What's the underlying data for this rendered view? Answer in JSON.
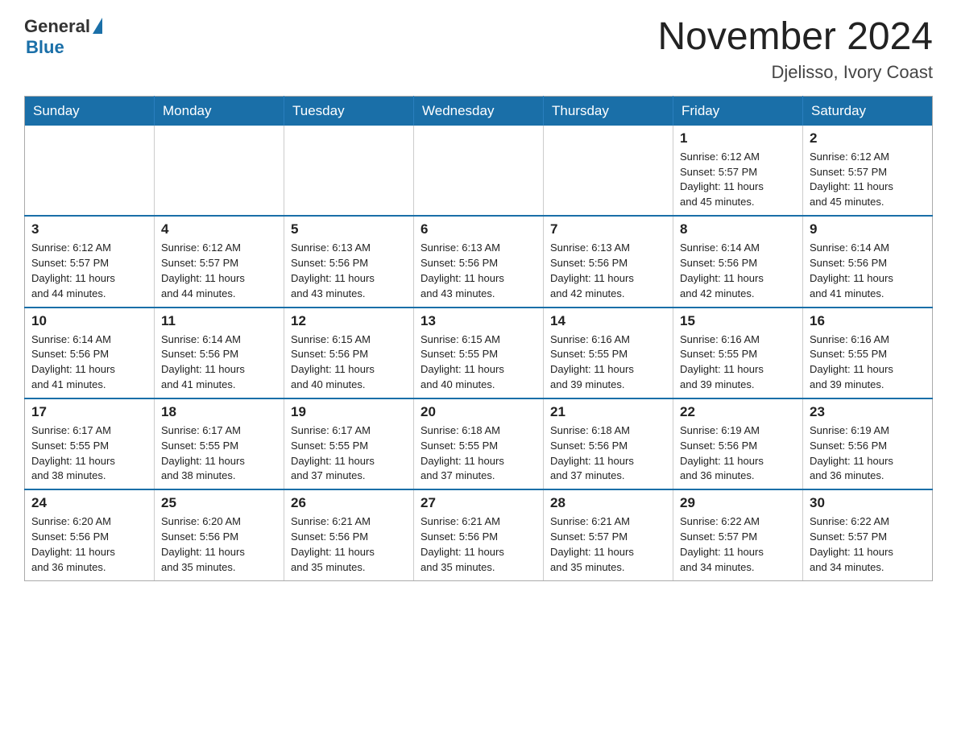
{
  "header": {
    "logo_general": "General",
    "logo_blue": "Blue",
    "month_title": "November 2024",
    "location": "Djelisso, Ivory Coast"
  },
  "days_of_week": [
    "Sunday",
    "Monday",
    "Tuesday",
    "Wednesday",
    "Thursday",
    "Friday",
    "Saturday"
  ],
  "weeks": [
    [
      {
        "day": "",
        "info": "",
        "empty": true
      },
      {
        "day": "",
        "info": "",
        "empty": true
      },
      {
        "day": "",
        "info": "",
        "empty": true
      },
      {
        "day": "",
        "info": "",
        "empty": true
      },
      {
        "day": "",
        "info": "",
        "empty": true
      },
      {
        "day": "1",
        "info": "Sunrise: 6:12 AM\nSunset: 5:57 PM\nDaylight: 11 hours\nand 45 minutes."
      },
      {
        "day": "2",
        "info": "Sunrise: 6:12 AM\nSunset: 5:57 PM\nDaylight: 11 hours\nand 45 minutes."
      }
    ],
    [
      {
        "day": "3",
        "info": "Sunrise: 6:12 AM\nSunset: 5:57 PM\nDaylight: 11 hours\nand 44 minutes."
      },
      {
        "day": "4",
        "info": "Sunrise: 6:12 AM\nSunset: 5:57 PM\nDaylight: 11 hours\nand 44 minutes."
      },
      {
        "day": "5",
        "info": "Sunrise: 6:13 AM\nSunset: 5:56 PM\nDaylight: 11 hours\nand 43 minutes."
      },
      {
        "day": "6",
        "info": "Sunrise: 6:13 AM\nSunset: 5:56 PM\nDaylight: 11 hours\nand 43 minutes."
      },
      {
        "day": "7",
        "info": "Sunrise: 6:13 AM\nSunset: 5:56 PM\nDaylight: 11 hours\nand 42 minutes."
      },
      {
        "day": "8",
        "info": "Sunrise: 6:14 AM\nSunset: 5:56 PM\nDaylight: 11 hours\nand 42 minutes."
      },
      {
        "day": "9",
        "info": "Sunrise: 6:14 AM\nSunset: 5:56 PM\nDaylight: 11 hours\nand 41 minutes."
      }
    ],
    [
      {
        "day": "10",
        "info": "Sunrise: 6:14 AM\nSunset: 5:56 PM\nDaylight: 11 hours\nand 41 minutes."
      },
      {
        "day": "11",
        "info": "Sunrise: 6:14 AM\nSunset: 5:56 PM\nDaylight: 11 hours\nand 41 minutes."
      },
      {
        "day": "12",
        "info": "Sunrise: 6:15 AM\nSunset: 5:56 PM\nDaylight: 11 hours\nand 40 minutes."
      },
      {
        "day": "13",
        "info": "Sunrise: 6:15 AM\nSunset: 5:55 PM\nDaylight: 11 hours\nand 40 minutes."
      },
      {
        "day": "14",
        "info": "Sunrise: 6:16 AM\nSunset: 5:55 PM\nDaylight: 11 hours\nand 39 minutes."
      },
      {
        "day": "15",
        "info": "Sunrise: 6:16 AM\nSunset: 5:55 PM\nDaylight: 11 hours\nand 39 minutes."
      },
      {
        "day": "16",
        "info": "Sunrise: 6:16 AM\nSunset: 5:55 PM\nDaylight: 11 hours\nand 39 minutes."
      }
    ],
    [
      {
        "day": "17",
        "info": "Sunrise: 6:17 AM\nSunset: 5:55 PM\nDaylight: 11 hours\nand 38 minutes."
      },
      {
        "day": "18",
        "info": "Sunrise: 6:17 AM\nSunset: 5:55 PM\nDaylight: 11 hours\nand 38 minutes."
      },
      {
        "day": "19",
        "info": "Sunrise: 6:17 AM\nSunset: 5:55 PM\nDaylight: 11 hours\nand 37 minutes."
      },
      {
        "day": "20",
        "info": "Sunrise: 6:18 AM\nSunset: 5:55 PM\nDaylight: 11 hours\nand 37 minutes."
      },
      {
        "day": "21",
        "info": "Sunrise: 6:18 AM\nSunset: 5:56 PM\nDaylight: 11 hours\nand 37 minutes."
      },
      {
        "day": "22",
        "info": "Sunrise: 6:19 AM\nSunset: 5:56 PM\nDaylight: 11 hours\nand 36 minutes."
      },
      {
        "day": "23",
        "info": "Sunrise: 6:19 AM\nSunset: 5:56 PM\nDaylight: 11 hours\nand 36 minutes."
      }
    ],
    [
      {
        "day": "24",
        "info": "Sunrise: 6:20 AM\nSunset: 5:56 PM\nDaylight: 11 hours\nand 36 minutes."
      },
      {
        "day": "25",
        "info": "Sunrise: 6:20 AM\nSunset: 5:56 PM\nDaylight: 11 hours\nand 35 minutes."
      },
      {
        "day": "26",
        "info": "Sunrise: 6:21 AM\nSunset: 5:56 PM\nDaylight: 11 hours\nand 35 minutes."
      },
      {
        "day": "27",
        "info": "Sunrise: 6:21 AM\nSunset: 5:56 PM\nDaylight: 11 hours\nand 35 minutes."
      },
      {
        "day": "28",
        "info": "Sunrise: 6:21 AM\nSunset: 5:57 PM\nDaylight: 11 hours\nand 35 minutes."
      },
      {
        "day": "29",
        "info": "Sunrise: 6:22 AM\nSunset: 5:57 PM\nDaylight: 11 hours\nand 34 minutes."
      },
      {
        "day": "30",
        "info": "Sunrise: 6:22 AM\nSunset: 5:57 PM\nDaylight: 11 hours\nand 34 minutes."
      }
    ]
  ]
}
